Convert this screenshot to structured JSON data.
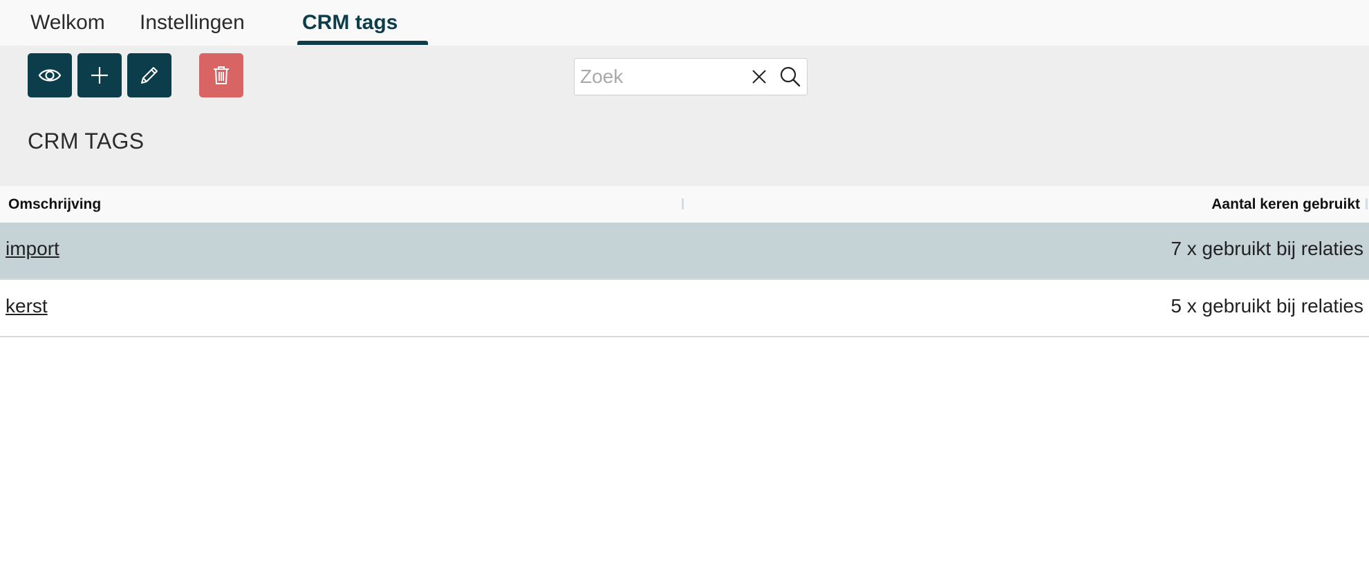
{
  "tabs": [
    {
      "label": "Welkom"
    },
    {
      "label": "Instellingen"
    },
    {
      "label": "CRM tags"
    }
  ],
  "active_tab": "CRM tags",
  "toolbar": {
    "view_icon": "eye-icon",
    "add_icon": "plus-icon",
    "edit_icon": "pencil-icon",
    "delete_icon": "trash-icon"
  },
  "search": {
    "placeholder": "Zoek",
    "value": "",
    "clear_icon": "close-icon",
    "search_icon": "search-icon"
  },
  "page_title": "CRM TAGS",
  "table": {
    "columns": [
      {
        "label": "Omschrijving"
      },
      {
        "label": "Aantal keren gebruikt"
      }
    ],
    "rows": [
      {
        "name": "import",
        "count": "7 x gebruikt bij relaties",
        "selected": true
      },
      {
        "name": "kerst",
        "count": "5 x gebruikt bij relaties",
        "selected": false
      }
    ]
  },
  "colors": {
    "primary": "#0c3d4a",
    "danger": "#d86464",
    "selected_row": "#c5d3d7",
    "toolbar_bg": "#eeeeee"
  }
}
